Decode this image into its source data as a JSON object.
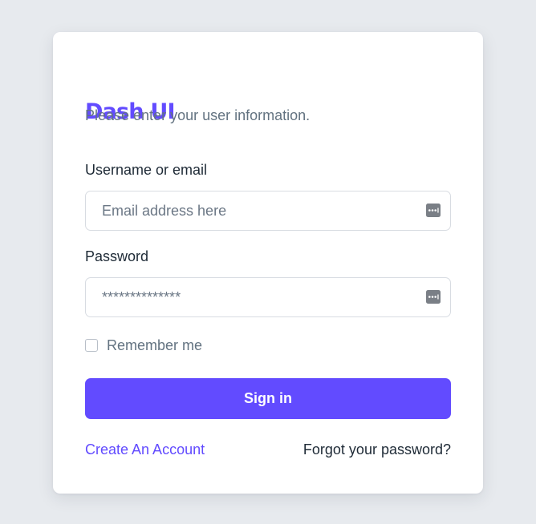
{
  "brand": {
    "name": "Dash UI",
    "color": "#624bff"
  },
  "subtitle": "Please enter your user information.",
  "form": {
    "username_label": "Username or email",
    "username_placeholder": "Email address here",
    "username_value": "",
    "password_label": "Password",
    "password_mask": "**************",
    "password_value": "",
    "field_icon": "password-manager-key-icon",
    "remember_label": "Remember me",
    "remember_checked": false,
    "submit_label": "Sign in"
  },
  "links": {
    "create_account": "Create An Account",
    "forgot_password": "Forgot your password?"
  },
  "colors": {
    "accent": "#624bff",
    "background": "#e7eaee",
    "card": "#ffffff",
    "muted_text": "#637381",
    "body_text": "#1e2a36"
  }
}
